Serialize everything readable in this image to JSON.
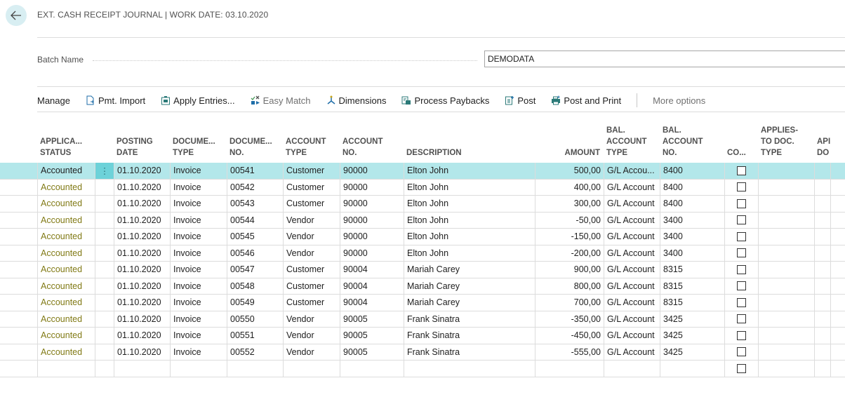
{
  "header": {
    "back_label": "Back",
    "title": "EXT. CASH RECEIPT JOURNAL | WORK DATE: 03.10.2020"
  },
  "batch": {
    "label": "Batch Name",
    "value": "DEMODATA"
  },
  "toolbar": {
    "manage": "Manage",
    "pmt_import": "Pmt. Import",
    "apply_entries": "Apply Entries...",
    "easy_match": "Easy Match",
    "dimensions": "Dimensions",
    "process_paybacks": "Process Paybacks",
    "post": "Post",
    "post_and_print": "Post and Print",
    "more_options": "More options"
  },
  "colors": {
    "selected_row": "#b3e7ea",
    "status_text": "#817a15",
    "back_button_bg": "#d8eef2"
  },
  "columns": {
    "status": [
      "APPLICA...",
      "STATUS"
    ],
    "posting_date": [
      "POSTING",
      "DATE"
    ],
    "doc_type": [
      "DOCUME...",
      "TYPE"
    ],
    "doc_no": [
      "DOCUME...",
      "NO."
    ],
    "account_type": [
      "ACCOUNT",
      "TYPE"
    ],
    "account_no": [
      "ACCOUNT",
      "NO."
    ],
    "description": "DESCRIPTION",
    "amount": "AMOUNT",
    "bal_account_type": [
      "BAL.",
      "ACCOUNT",
      "TYPE"
    ],
    "bal_account_no": [
      "BAL.",
      "ACCOUNT",
      "NO."
    ],
    "correction": "CO...",
    "applies_to_doc_type": [
      "APPLIES-",
      "TO DOC.",
      "TYPE"
    ],
    "applies_to_doc_no": [
      "API",
      "DO"
    ]
  },
  "rows": [
    {
      "status": "Accounted",
      "posting_date": "01.10.2020",
      "doc_type": "Invoice",
      "doc_no": "00541",
      "account_type": "Customer",
      "account_no": "90000",
      "description": "Elton John",
      "amount": "500,00",
      "bal_account_type": "G/L Accou...",
      "bal_account_no": "8400",
      "selected": true
    },
    {
      "status": "Accounted",
      "posting_date": "01.10.2020",
      "doc_type": "Invoice",
      "doc_no": "00542",
      "account_type": "Customer",
      "account_no": "90000",
      "description": "Elton John",
      "amount": "400,00",
      "bal_account_type": "G/L Account",
      "bal_account_no": "8400"
    },
    {
      "status": "Accounted",
      "posting_date": "01.10.2020",
      "doc_type": "Invoice",
      "doc_no": "00543",
      "account_type": "Customer",
      "account_no": "90000",
      "description": "Elton John",
      "amount": "300,00",
      "bal_account_type": "G/L Account",
      "bal_account_no": "8400"
    },
    {
      "status": "Accounted",
      "posting_date": "01.10.2020",
      "doc_type": "Invoice",
      "doc_no": "00544",
      "account_type": "Vendor",
      "account_no": "90000",
      "description": "Elton John",
      "amount": "-50,00",
      "bal_account_type": "G/L Account",
      "bal_account_no": "3400"
    },
    {
      "status": "Accounted",
      "posting_date": "01.10.2020",
      "doc_type": "Invoice",
      "doc_no": "00545",
      "account_type": "Vendor",
      "account_no": "90000",
      "description": "Elton John",
      "amount": "-150,00",
      "bal_account_type": "G/L Account",
      "bal_account_no": "3400"
    },
    {
      "status": "Accounted",
      "posting_date": "01.10.2020",
      "doc_type": "Invoice",
      "doc_no": "00546",
      "account_type": "Vendor",
      "account_no": "90000",
      "description": "Elton John",
      "amount": "-200,00",
      "bal_account_type": "G/L Account",
      "bal_account_no": "3400"
    },
    {
      "status": "Accounted",
      "posting_date": "01.10.2020",
      "doc_type": "Invoice",
      "doc_no": "00547",
      "account_type": "Customer",
      "account_no": "90004",
      "description": "Mariah Carey",
      "amount": "900,00",
      "bal_account_type": "G/L Account",
      "bal_account_no": "8315"
    },
    {
      "status": "Accounted",
      "posting_date": "01.10.2020",
      "doc_type": "Invoice",
      "doc_no": "00548",
      "account_type": "Customer",
      "account_no": "90004",
      "description": "Mariah Carey",
      "amount": "800,00",
      "bal_account_type": "G/L Account",
      "bal_account_no": "8315"
    },
    {
      "status": "Accounted",
      "posting_date": "01.10.2020",
      "doc_type": "Invoice",
      "doc_no": "00549",
      "account_type": "Customer",
      "account_no": "90004",
      "description": "Mariah Carey",
      "amount": "700,00",
      "bal_account_type": "G/L Account",
      "bal_account_no": "8315"
    },
    {
      "status": "Accounted",
      "posting_date": "01.10.2020",
      "doc_type": "Invoice",
      "doc_no": "00550",
      "account_type": "Vendor",
      "account_no": "90005",
      "description": "Frank Sinatra",
      "amount": "-350,00",
      "bal_account_type": "G/L Account",
      "bal_account_no": "3425"
    },
    {
      "status": "Accounted",
      "posting_date": "01.10.2020",
      "doc_type": "Invoice",
      "doc_no": "00551",
      "account_type": "Vendor",
      "account_no": "90005",
      "description": "Frank Sinatra",
      "amount": "-450,00",
      "bal_account_type": "G/L Account",
      "bal_account_no": "3425"
    },
    {
      "status": "Accounted",
      "posting_date": "01.10.2020",
      "doc_type": "Invoice",
      "doc_no": "00552",
      "account_type": "Vendor",
      "account_no": "90005",
      "description": "Frank Sinatra",
      "amount": "-555,00",
      "bal_account_type": "G/L Account",
      "bal_account_no": "3425"
    },
    {
      "status": "",
      "posting_date": "",
      "doc_type": "",
      "doc_no": "",
      "account_type": "",
      "account_no": "",
      "description": "",
      "amount": "",
      "bal_account_type": "",
      "bal_account_no": ""
    }
  ]
}
